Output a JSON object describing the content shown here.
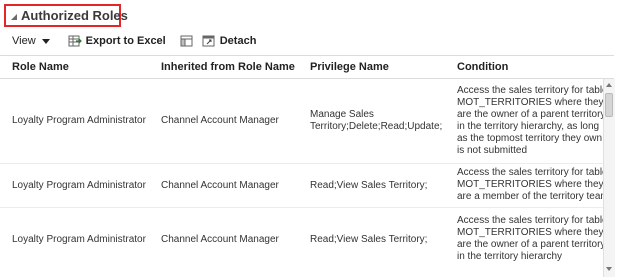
{
  "section": {
    "title": "Authorized Roles"
  },
  "toolbar": {
    "view_label": "View",
    "export_label": "Export to Excel",
    "detach_label": "Detach"
  },
  "table": {
    "columns": [
      "Role Name",
      "Inherited from Role Name",
      "Privilege Name",
      "Condition"
    ],
    "rows": [
      {
        "role": "Loyalty Program Administrator",
        "inherited": "Channel Account Manager",
        "privilege_lines": [
          "Manage Sales",
          "Territory;Delete;Read;Update;"
        ],
        "condition_lines": [
          "Access the sales territory for table",
          "MOT_TERRITORIES where they",
          "are the owner of a parent territory",
          "in the territory hierarchy, as long",
          "as the topmost territory they own",
          "is not submitted"
        ]
      },
      {
        "role": "Loyalty Program Administrator",
        "inherited": "Channel Account Manager",
        "privilege_lines": [
          "Read;View Sales Territory;"
        ],
        "condition_lines": [
          "Access the sales territory for table",
          "MOT_TERRITORIES where they",
          "are a member of the territory team"
        ]
      },
      {
        "role": "Loyalty Program Administrator",
        "inherited": "Channel Account Manager",
        "privilege_lines": [
          "Read;View Sales Territory;"
        ],
        "condition_lines": [
          "Access the sales territory for table",
          "MOT_TERRITORIES where they",
          "are the owner of a parent territory",
          "in the territory hierarchy"
        ]
      }
    ]
  }
}
